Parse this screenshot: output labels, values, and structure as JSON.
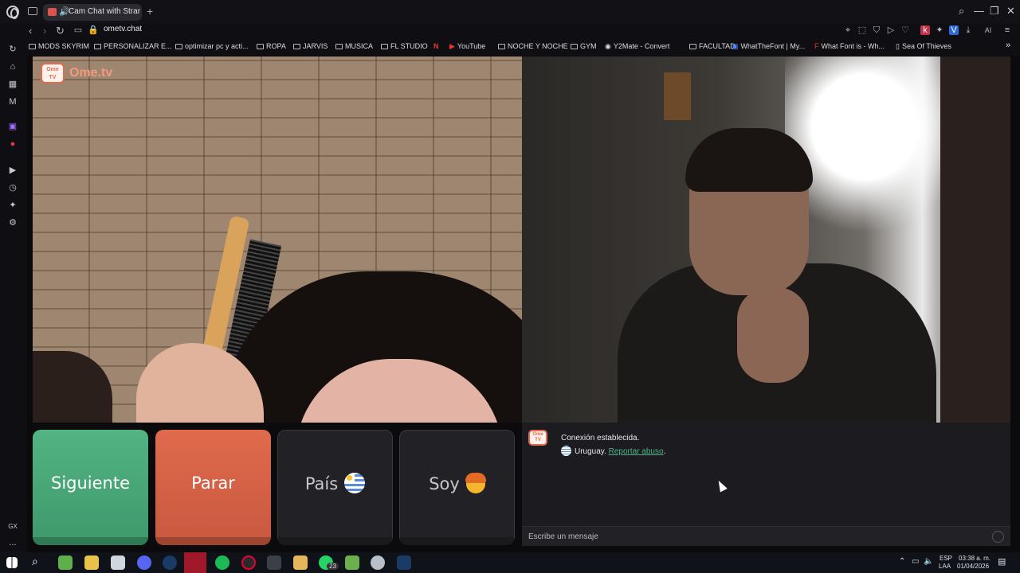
{
  "browser": {
    "tab_title": "Cam Chat with Strange",
    "new_tab": "+",
    "url": "ometv.chat",
    "window_controls": [
      "⌕",
      "—",
      "❐",
      "✕"
    ],
    "nav": {
      "back": "‹",
      "forward": "›",
      "reload": "↻"
    },
    "toolbar_ai": "AI"
  },
  "bookmarks": [
    {
      "label": "MODS SKYRIM"
    },
    {
      "label": "PERSONALIZAR E..."
    },
    {
      "label": "optimizar pc y acti..."
    },
    {
      "label": "ROPA"
    },
    {
      "label": "JARVIS"
    },
    {
      "label": "MUSICA"
    },
    {
      "label": "FL STUDIO"
    },
    {
      "label": "YouTube"
    },
    {
      "label": "NOCHE Y NOCHE"
    },
    {
      "label": "GYM"
    },
    {
      "label": "Y2Mate - Convert"
    },
    {
      "label": "FACULTAD"
    },
    {
      "label": "WhatTheFont | My..."
    },
    {
      "label": "What Font is - Wh..."
    },
    {
      "label": "Sea Of Thieves"
    }
  ],
  "sidebar": {
    "bottom_label": "GX",
    "more": "..."
  },
  "site": {
    "logo_text": "Ome.tv",
    "logo_badge": "Ome TV"
  },
  "controls": {
    "next": "Siguiente",
    "stop": "Parar",
    "country": "País",
    "gender": "Soy"
  },
  "chat": {
    "status": "Conexión establecida.",
    "country": "Uruguay.",
    "report": "Reportar abuso",
    "report_suffix": ".",
    "placeholder": "Escribe un mensaje"
  },
  "taskbar": {
    "whatsapp_badge": "23",
    "lang": "ESP",
    "lang2": "LAA",
    "time": "03:38 a. m.",
    "date": "01/04/2026"
  },
  "colors": {
    "next": "#53b383",
    "stop": "#e06a4c",
    "accent_link": "#4fb38a",
    "logo": "#e46a51"
  }
}
